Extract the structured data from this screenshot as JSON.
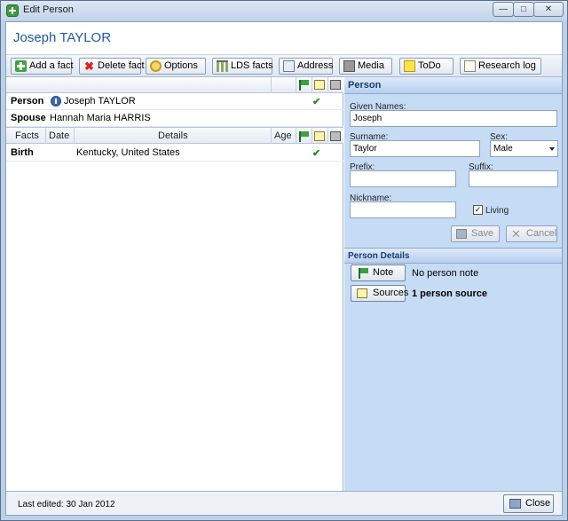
{
  "window": {
    "title": "Edit Person",
    "min_label": "—",
    "max_label": "□",
    "close_label": "✕"
  },
  "header": {
    "person_name": "Joseph TAYLOR"
  },
  "toolbar": {
    "add_fact": "Add a fact",
    "delete_fact": "Delete fact",
    "options": "Options",
    "lds_facts": "LDS facts",
    "address": "Address",
    "media": "Media",
    "todo": "ToDo",
    "research_log": "Research log"
  },
  "grid": {
    "person_label": "Person",
    "person_value": "Joseph TAYLOR",
    "spouse_label": "Spouse",
    "spouse_value": "Hannah Maria HARRIS",
    "facts_headers": {
      "facts": "Facts",
      "date": "Date",
      "details": "Details",
      "age": "Age"
    },
    "facts": [
      {
        "fact": "Birth",
        "date": "",
        "details": "Kentucky, United States",
        "age": ""
      }
    ],
    "check_mark": "✔"
  },
  "person_panel": {
    "title": "Person",
    "given_names_label": "Given Names:",
    "given_names": "Joseph",
    "surname_label": "Surname:",
    "surname": "Taylor",
    "sex_label": "Sex:",
    "sex": "Male",
    "prefix_label": "Prefix:",
    "prefix": "",
    "suffix_label": "Suffix:",
    "suffix": "",
    "nickname_label": "Nickname:",
    "nickname": "",
    "living_label": "Living",
    "living_checked": true,
    "save_label": "Save",
    "cancel_label": "Cancel"
  },
  "details_panel": {
    "title": "Person Details",
    "note_button": "Note",
    "note_status": "No person note",
    "sources_button": "Sources",
    "sources_status": "1 person source"
  },
  "footer": {
    "last_edited": "Last edited: 30 Jan 2012",
    "close_label": "Close"
  }
}
